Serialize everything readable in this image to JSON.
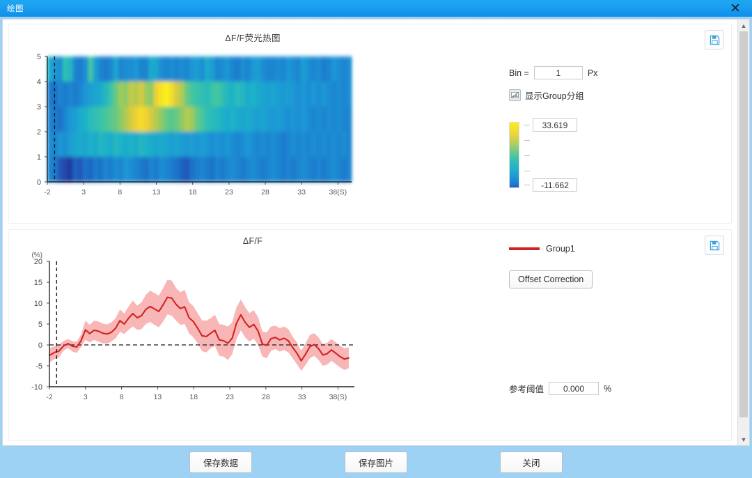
{
  "window": {
    "title": "绘图",
    "close_icon": "close-icon"
  },
  "heatmap_panel": {
    "title": "ΔF/F荧光热图",
    "save_icon": "save-floppy-icon",
    "controls": {
      "bin_label": "Bin =",
      "bin_value": "1",
      "bin_unit": "Px",
      "group_toggle_label": "显示Group分组",
      "group_toggle_icon": "image-group-icon",
      "colorbar_max": "33.619",
      "colorbar_min": "-11.662"
    }
  },
  "line_panel": {
    "title": "ΔF/F",
    "save_icon": "save-floppy-icon",
    "legend": {
      "label": "Group1",
      "color": "#d02424"
    },
    "offset_button": "Offset Correction",
    "threshold_label": "参考阈值",
    "threshold_value": "0.000",
    "threshold_unit": "%"
  },
  "footer": {
    "save_data": "保存数据",
    "save_image": "保存图片",
    "close": "关闭"
  },
  "scrollbar": {
    "up_arrow": "chevron-up-icon",
    "down_arrow": "chevron-down-icon"
  },
  "chart_data": [
    {
      "type": "heatmap",
      "title": "ΔF/F荧光热图",
      "xlabel": "",
      "ylabel": "",
      "xticks": [
        "-2",
        "3",
        "8",
        "13",
        "18",
        "23",
        "28",
        "33",
        "38(S)"
      ],
      "yticks": [
        "0",
        "1",
        "2",
        "3",
        "4",
        "5"
      ],
      "xlim": [
        -2,
        40
      ],
      "ylim": [
        0,
        5
      ],
      "colorbar": {
        "min": -11.662,
        "max": 33.619,
        "colormap": "parula"
      },
      "event_marker_x": -1,
      "rows": 5,
      "grid": false,
      "values": [
        [
          14,
          11,
          10,
          18,
          16,
          9,
          8,
          10,
          20,
          12,
          9,
          8,
          9,
          13,
          9,
          10,
          10,
          11,
          9,
          9,
          14,
          13,
          10,
          9,
          10,
          9,
          10,
          9,
          11,
          12,
          10,
          14,
          12,
          9,
          10,
          11,
          9,
          8,
          10,
          9,
          11,
          12,
          10,
          9,
          9,
          10,
          9,
          11,
          10,
          9,
          12,
          10,
          9,
          10,
          8,
          9,
          11,
          10,
          9,
          10
        ],
        [
          8,
          7,
          9,
          8,
          9,
          8,
          9,
          11,
          12,
          13,
          14,
          16,
          19,
          22,
          25,
          24,
          27,
          26,
          28,
          25,
          24,
          30,
          32,
          33,
          31,
          28,
          26,
          22,
          20,
          19,
          18,
          17,
          19,
          20,
          18,
          16,
          15,
          17,
          16,
          14,
          15,
          14,
          13,
          12,
          13,
          12,
          11,
          12,
          11,
          10,
          11,
          10,
          11,
          10,
          11,
          10,
          9,
          10,
          9,
          10
        ],
        [
          9,
          8,
          7,
          9,
          11,
          12,
          14,
          15,
          17,
          18,
          19,
          20,
          21,
          22,
          24,
          26,
          28,
          30,
          31,
          30,
          28,
          26,
          24,
          22,
          21,
          22,
          24,
          26,
          25,
          22,
          20,
          18,
          17,
          16,
          15,
          14,
          15,
          14,
          13,
          14,
          13,
          12,
          13,
          12,
          11,
          12,
          11,
          10,
          11,
          10,
          11,
          10,
          9,
          10,
          9,
          10,
          9,
          10,
          9,
          9
        ],
        [
          10,
          9,
          11,
          10,
          12,
          13,
          14,
          13,
          15,
          14,
          16,
          15,
          14,
          16,
          15,
          14,
          15,
          14,
          16,
          15,
          14,
          13,
          14,
          13,
          12,
          13,
          12,
          11,
          12,
          11,
          12,
          11,
          10,
          11,
          10,
          11,
          10,
          9,
          10,
          11,
          10,
          9,
          10,
          9,
          10,
          9,
          8,
          9,
          10,
          9,
          10,
          9,
          10,
          9,
          10,
          9,
          10,
          9,
          10,
          9
        ],
        [
          9,
          8,
          5,
          4,
          3,
          6,
          5,
          7,
          6,
          8,
          7,
          9,
          8,
          10,
          9,
          11,
          10,
          9,
          8,
          7,
          9,
          8,
          10,
          9,
          8,
          7,
          6,
          5,
          7,
          8,
          9,
          8,
          7,
          9,
          8,
          9,
          10,
          9,
          8,
          9,
          10,
          9,
          8,
          9,
          10,
          9,
          8,
          9,
          8,
          9,
          10,
          9,
          8,
          9,
          8,
          9,
          10,
          9,
          8,
          9
        ]
      ]
    },
    {
      "type": "line",
      "title": "ΔF/F",
      "xlabel": "",
      "ylabel": "(%)",
      "xticks": [
        "-2",
        "3",
        "8",
        "13",
        "18",
        "23",
        "28",
        "33",
        "38(S)"
      ],
      "yticks": [
        "-10",
        "-5",
        "0",
        "5",
        "10",
        "15",
        "20"
      ],
      "xlim": [
        -2,
        40
      ],
      "ylim": [
        -10,
        20
      ],
      "zero_line": 0,
      "event_marker_x": -1,
      "legend_position": "right",
      "grid": false,
      "series": [
        {
          "name": "Group1",
          "color": "#d02424",
          "band_color": "#f79a9a",
          "x": [
            -2,
            -1.3,
            -0.7,
            0,
            0.6,
            1.2,
            1.8,
            2.4,
            3,
            3.6,
            4.2,
            4.8,
            5.4,
            6,
            6.6,
            7.2,
            7.8,
            8.4,
            9,
            9.6,
            10.2,
            10.8,
            11.4,
            12,
            12.6,
            13.2,
            13.8,
            14.4,
            15,
            15.6,
            16.2,
            16.8,
            17.4,
            18,
            18.6,
            19.2,
            19.8,
            20.4,
            21,
            21.6,
            22.2,
            22.8,
            23.4,
            24,
            24.6,
            25.2,
            25.8,
            26.4,
            27,
            27.6,
            28.2,
            28.8,
            29.4,
            30,
            30.6,
            31.2,
            31.8,
            32.4,
            33,
            33.6,
            34.2,
            34.8,
            35.4,
            36,
            36.6,
            37.2,
            37.8,
            38.4,
            39,
            39.6
          ],
          "mean": [
            -2.5,
            -1.8,
            -1.5,
            -0.2,
            0.3,
            -0.3,
            -0.5,
            1.0,
            3.6,
            2.7,
            3.5,
            3.3,
            2.8,
            2.6,
            3.0,
            4.0,
            5.8,
            5.0,
            6.4,
            7.5,
            6.5,
            7.0,
            8.5,
            9.2,
            8.6,
            8.0,
            9.6,
            11.4,
            11.2,
            9.7,
            8.7,
            9.1,
            6.5,
            5.6,
            4.0,
            2.2,
            2.0,
            2.8,
            3.5,
            1.2,
            1.0,
            0.4,
            1.6,
            5.2,
            7.2,
            5.4,
            4.2,
            4.9,
            3.3,
            0.2,
            -0.1,
            1.5,
            1.8,
            1.2,
            1.6,
            1.0,
            -0.6,
            -2.0,
            -3.8,
            -2.2,
            -0.4,
            0.1,
            -0.9,
            -2.4,
            -2.1,
            -1.2,
            -2.0,
            -2.8,
            -3.4,
            -3.1
          ],
          "lower": [
            -4.2,
            -3.4,
            -3.0,
            -1.3,
            -0.8,
            -1.6,
            -1.9,
            -0.5,
            1.2,
            0.6,
            1.2,
            0.8,
            0.4,
            0.3,
            0.8,
            1.6,
            3.1,
            2.6,
            3.6,
            4.4,
            3.6,
            3.8,
            5.0,
            5.5,
            4.8,
            4.2,
            5.6,
            7.3,
            7.0,
            5.8,
            4.8,
            5.0,
            2.8,
            1.8,
            0.4,
            -1.5,
            -1.8,
            -0.8,
            -0.2,
            -2.6,
            -2.8,
            -3.6,
            -2.2,
            1.4,
            3.5,
            1.8,
            0.8,
            1.5,
            0.0,
            -2.8,
            -3.2,
            -1.4,
            -1.0,
            -1.6,
            -1.2,
            -1.8,
            -3.2,
            -4.6,
            -6.2,
            -4.8,
            -3.2,
            -2.6,
            -3.6,
            -5.0,
            -4.7,
            -3.8,
            -4.6,
            -5.4,
            -6.0,
            -5.6
          ],
          "upper": [
            -0.8,
            -0.3,
            0.0,
            1.0,
            1.4,
            0.9,
            0.8,
            2.5,
            5.8,
            4.8,
            5.8,
            5.6,
            5.1,
            4.9,
            5.4,
            6.4,
            8.5,
            7.5,
            9.2,
            10.6,
            9.4,
            10.2,
            12.0,
            13.0,
            12.4,
            11.8,
            13.6,
            15.6,
            15.4,
            13.6,
            12.6,
            13.2,
            10.2,
            9.3,
            7.6,
            5.9,
            5.8,
            6.4,
            7.2,
            5.0,
            4.8,
            4.4,
            5.4,
            9.0,
            10.9,
            9.0,
            7.6,
            8.3,
            6.6,
            3.2,
            3.0,
            4.4,
            4.6,
            4.0,
            4.4,
            3.8,
            2.0,
            0.6,
            -1.4,
            0.4,
            2.4,
            2.8,
            1.8,
            0.2,
            0.5,
            1.4,
            0.6,
            -0.2,
            -0.8,
            -0.6
          ]
        }
      ]
    }
  ]
}
